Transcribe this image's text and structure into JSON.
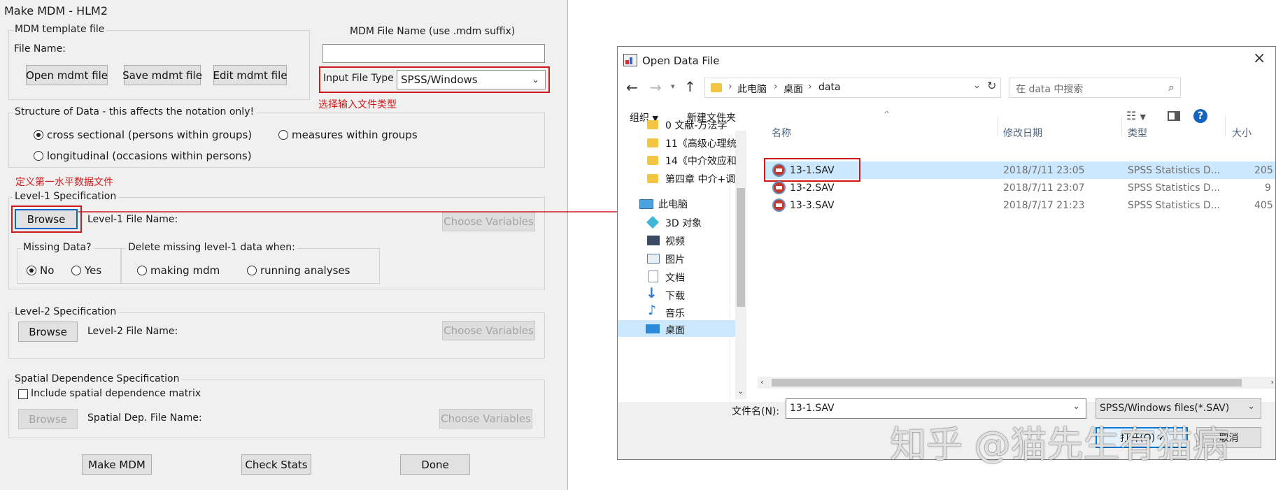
{
  "hlm": {
    "title": "Make MDM - HLM2",
    "template_group": "MDM template file",
    "file_name_label": "File Name:",
    "open_btn": "Open mdmt file",
    "save_btn": "Save mdmt file",
    "edit_btn": "Edit mdmt file",
    "mdm_name_label": "MDM File Name (use .mdm suffix)",
    "mdm_name_value": "",
    "input_type_label": "Input File Type",
    "input_type_value": "SPSS/Windows",
    "annot_input_type": "选择输入文件类型",
    "structure_group": "Structure of Data - this affects the notation only!",
    "opt_cross": "cross sectional (persons within groups)",
    "opt_measures": "measures within groups",
    "opt_long": "longitudinal (occasions within persons)",
    "annot_level1": "定义第一水平数据文件",
    "level1_group": "Level-1 Specification",
    "browse": "Browse",
    "level1_file_label": "Level-1 File Name:",
    "choose_vars": "Choose Variables",
    "missing_group": "Missing Data?",
    "delete_group": "Delete missing level-1 data when:",
    "no": "No",
    "yes": "Yes",
    "making_mdm": "making mdm",
    "running_analyses": "running analyses",
    "level2_group": "Level-2 Specification",
    "level2_file_label": "Level-2 File Name:",
    "spatial_group": "Spatial Dependence Specification",
    "include_spatial": "Include spatial dependence matrix",
    "spatial_file_label": "Spatial Dep. File Name:",
    "make_mdm": "Make MDM",
    "check_stats": "Check Stats",
    "done": "Done"
  },
  "dialog": {
    "title": "Open Data File",
    "breadcrumb": [
      "此电脑",
      "桌面",
      "data"
    ],
    "search_placeholder": "在 data 中搜索",
    "organize": "组织",
    "new_folder": "新建文件夹",
    "nav_items": [
      "0 文献-方法学",
      "11《高级心理统",
      "14《中介效应和",
      "第四章 中介+调",
      "此电脑",
      "3D 对象",
      "视频",
      "图片",
      "文档",
      "下载",
      "音乐",
      "桌面"
    ],
    "columns": {
      "name": "名称",
      "date": "修改日期",
      "type": "类型",
      "size": "大小"
    },
    "files": [
      {
        "name": "13-1.SAV",
        "date": "2018/7/11 23:05",
        "type": "SPSS Statistics D...",
        "size": "205"
      },
      {
        "name": "13-2.SAV",
        "date": "2018/7/11 23:07",
        "type": "SPSS Statistics D...",
        "size": "9"
      },
      {
        "name": "13-3.SAV",
        "date": "2018/7/17 21:23",
        "type": "SPSS Statistics D...",
        "size": "405"
      }
    ],
    "filename_label": "文件名(N):",
    "filename_value": "13-1.SAV",
    "filetype_value": "SPSS/Windows files(*.SAV)",
    "open_btn": "打开(O)",
    "cancel_btn": "取消"
  },
  "watermark": "知乎 @猫先生有猫病",
  "colors": {
    "annotation": "#cc1a1a",
    "selection": "#cce8ff",
    "focus": "#0a64c8"
  }
}
